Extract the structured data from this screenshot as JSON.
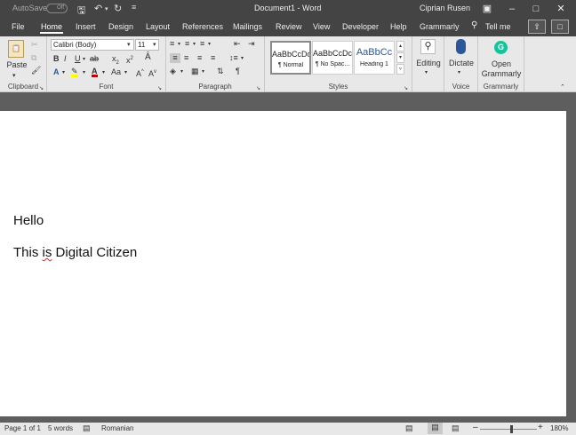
{
  "titlebar": {
    "autosave_label": "AutoSave",
    "autosave_state": "Off",
    "doc_title": "Document1 - Word",
    "user": "Ciprian Rusen"
  },
  "tabs": [
    "File",
    "Home",
    "Insert",
    "Design",
    "Layout",
    "References",
    "Mailings",
    "Review",
    "View",
    "Developer",
    "Help",
    "Grammarly"
  ],
  "tell_me": "Tell me",
  "ribbon": {
    "clipboard": {
      "paste": "Paste",
      "label": "Clipboard"
    },
    "font": {
      "family": "Calibri (Body)",
      "size": "11",
      "label": "Font"
    },
    "paragraph": {
      "label": "Paragraph"
    },
    "styles": {
      "label": "Styles",
      "items": [
        {
          "sample": "AaBbCcDc",
          "name": "¶ Normal"
        },
        {
          "sample": "AaBbCcDc",
          "name": "¶ No Spac..."
        },
        {
          "sample": "AaBbCc",
          "name": "Heading 1"
        }
      ]
    },
    "editing": {
      "label": "Editing"
    },
    "voice": {
      "dictate": "Dictate",
      "label": "Voice"
    },
    "grammarly": {
      "open1": "Open",
      "open2": "Grammarly",
      "label": "Grammarly"
    }
  },
  "document": {
    "line1": "Hello",
    "line2_pre": "This ",
    "line2_err": "is",
    "line2_post": " Digital Citizen"
  },
  "status": {
    "page": "Page 1 of 1",
    "words": "5 words",
    "language": "Romanian",
    "zoom": "180%",
    "minus": "–",
    "plus": "+"
  },
  "colors": {
    "accent": "#2b579a",
    "highlight": "#ffff00",
    "font_color": "#c00000"
  }
}
